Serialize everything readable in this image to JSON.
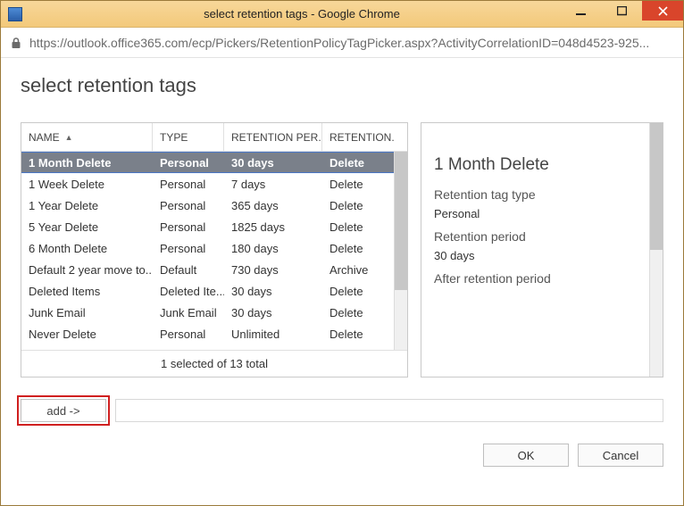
{
  "window": {
    "title": "select retention tags - Google Chrome",
    "url": "https://outlook.office365.com/ecp/Pickers/RetentionPolicyTagPicker.aspx?ActivityCorrelationID=048d4523-925..."
  },
  "page": {
    "heading": "select retention tags"
  },
  "columns": {
    "name": "NAME",
    "type": "TYPE",
    "period": "RETENTION PER...",
    "action": "RETENTION..."
  },
  "rows": [
    {
      "name": "1 Month Delete",
      "type": "Personal",
      "period": "30 days",
      "action": "Delete",
      "selected": true
    },
    {
      "name": "1 Week Delete",
      "type": "Personal",
      "period": "7 days",
      "action": "Delete"
    },
    {
      "name": "1 Year Delete",
      "type": "Personal",
      "period": "365 days",
      "action": "Delete"
    },
    {
      "name": "5 Year Delete",
      "type": "Personal",
      "period": "1825 days",
      "action": "Delete"
    },
    {
      "name": "6 Month Delete",
      "type": "Personal",
      "period": "180 days",
      "action": "Delete"
    },
    {
      "name": "Default 2 year move to...",
      "type": "Default",
      "period": "730 days",
      "action": "Archive"
    },
    {
      "name": "Deleted Items",
      "type": "Deleted Ite...",
      "period": "30 days",
      "action": "Delete"
    },
    {
      "name": "Junk Email",
      "type": "Junk Email",
      "period": "30 days",
      "action": "Delete"
    },
    {
      "name": "Never Delete",
      "type": "Personal",
      "period": "Unlimited",
      "action": "Delete"
    }
  ],
  "footer": {
    "text": "1 selected of 13 total"
  },
  "detail": {
    "title": "1 Month Delete",
    "type_label": "Retention tag type",
    "type_value": "Personal",
    "period_label": "Retention period",
    "period_value": "30 days",
    "after_label": "After retention period"
  },
  "buttons": {
    "add": "add ->",
    "ok": "OK",
    "cancel": "Cancel"
  },
  "add_input": {
    "value": ""
  }
}
